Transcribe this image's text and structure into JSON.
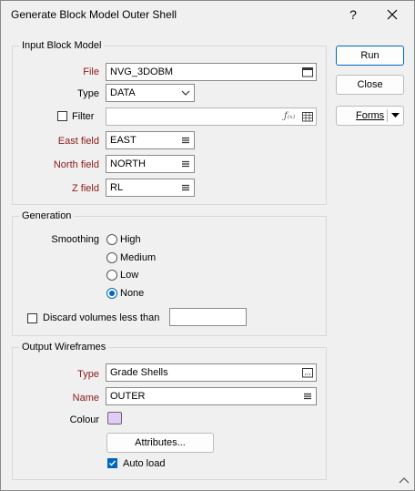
{
  "window": {
    "title": "Generate Block Model Outer Shell",
    "help": "?"
  },
  "buttons": {
    "run": "Run",
    "close": "Close",
    "forms": "Forms"
  },
  "input_block_model": {
    "legend": "Input Block Model",
    "file_label": "File",
    "file_value": "NVG_3DOBM",
    "type_label": "Type",
    "type_value": "DATA",
    "filter_label": "Filter",
    "filter_value": "",
    "filter_checked": false,
    "east_label": "East field",
    "east_value": "EAST",
    "north_label": "North field",
    "north_value": "NORTH",
    "z_label": "Z field",
    "z_value": "RL"
  },
  "generation": {
    "legend": "Generation",
    "smoothing_label": "Smoothing",
    "options": [
      "High",
      "Medium",
      "Low",
      "None"
    ],
    "selected": "None",
    "discard_label": "Discard volumes less than",
    "discard_checked": false,
    "discard_value": ""
  },
  "output_wireframes": {
    "legend": "Output Wireframes",
    "type_label": "Type",
    "type_value": "Grade Shells",
    "name_label": "Name",
    "name_value": "OUTER",
    "colour_label": "Colour",
    "colour_value": "#e0cdf7",
    "attributes_button": "Attributes...",
    "autoload_label": "Auto load",
    "autoload_checked": true
  },
  "colors": {
    "accent": "#0067c0",
    "required_label": "#8b1a1a"
  }
}
